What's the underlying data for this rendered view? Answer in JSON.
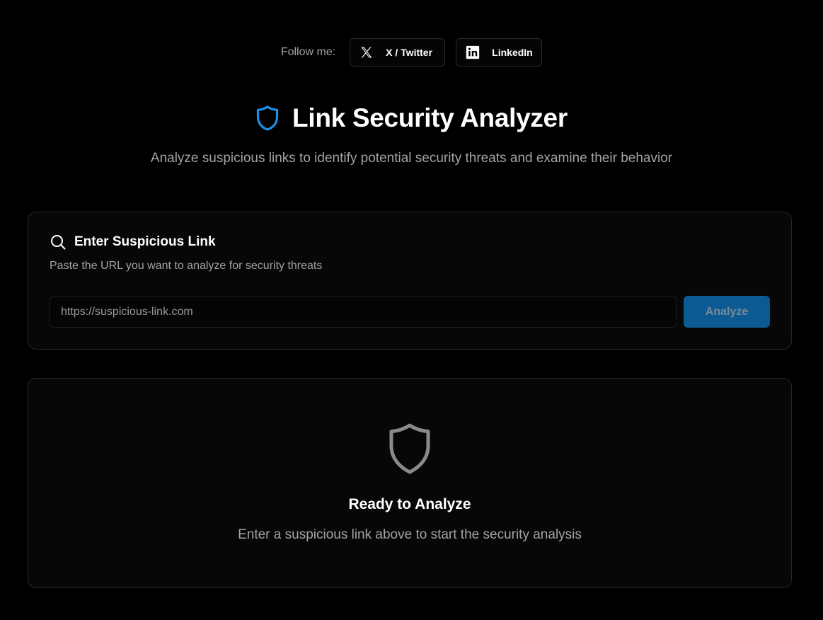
{
  "follow": {
    "label": "Follow me:",
    "twitter": {
      "label": "X / Twitter",
      "icon": "x-logo-icon"
    },
    "linkedin": {
      "label": "LinkedIn",
      "icon": "linkedin-logo-icon"
    }
  },
  "header": {
    "title": "Link Security Analyzer",
    "subtitle": "Analyze suspicious links to identify potential security threats and examine their behavior",
    "icon": "shield-icon",
    "accent_color": "#1d8fe6"
  },
  "input_card": {
    "heading": "Enter Suspicious Link",
    "heading_icon": "search-icon",
    "description": "Paste the URL you want to analyze for security threats",
    "url_placeholder": "https://suspicious-link.com",
    "url_value": "",
    "analyze_label": "Analyze",
    "analyze_color": "#0b5a94"
  },
  "empty_state": {
    "icon": "shield-icon",
    "title": "Ready to Analyze",
    "description": "Enter a suspicious link above to start the security analysis"
  }
}
